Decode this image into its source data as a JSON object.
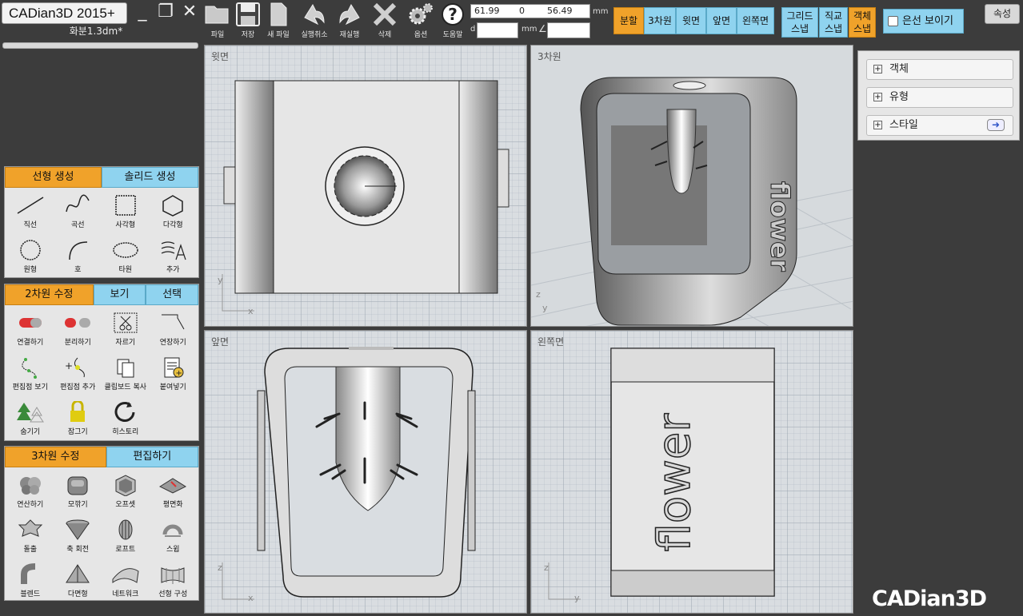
{
  "app": {
    "title": "CADian3D 2015+",
    "file_name": "화분1.3dm*",
    "brand": "CADian3D"
  },
  "window_controls": [
    "_",
    "❐",
    "✕"
  ],
  "toolbar": [
    {
      "label": "파일",
      "icon": "folder-icon"
    },
    {
      "label": "저장",
      "icon": "save-icon"
    },
    {
      "label": "새 파일",
      "icon": "new-file-icon"
    },
    {
      "label": "실행취소",
      "icon": "undo-icon"
    },
    {
      "label": "재실행",
      "icon": "redo-icon"
    },
    {
      "label": "삭제",
      "icon": "delete-icon"
    },
    {
      "label": "옵션",
      "icon": "gear-icon"
    },
    {
      "label": "도움말",
      "icon": "help-icon"
    }
  ],
  "coords": {
    "x": "61.99",
    "y": "0",
    "z": "56.49",
    "unit": "mm",
    "d_label": "d",
    "d_value": "",
    "d_unit": "mm",
    "angle_symbol": "∠",
    "angle_value": ""
  },
  "view_buttons": [
    {
      "label": "분할",
      "active": true
    },
    {
      "label": "3차원",
      "active": false
    },
    {
      "label": "윗면",
      "active": false
    },
    {
      "label": "앞면",
      "active": false
    },
    {
      "label": "왼쪽면",
      "active": false
    }
  ],
  "snap_buttons": [
    {
      "line1": "그리드",
      "line2": "스냅",
      "active": false
    },
    {
      "line1": "직교",
      "line2": "스냅",
      "active": false
    },
    {
      "line1": "객체",
      "line2": "스냅",
      "active": true
    }
  ],
  "hidden_lines": {
    "label": "은선 보이기",
    "checked": false
  },
  "properties_button": "속성",
  "panels": {
    "linear": {
      "tabs": [
        {
          "label": "선형 생성",
          "active": true
        },
        {
          "label": "솔리드 생성",
          "active": false
        }
      ],
      "tools": [
        {
          "label": "직선",
          "icon": "line-icon"
        },
        {
          "label": "곡선",
          "icon": "curve-icon"
        },
        {
          "label": "사각형",
          "icon": "rectangle-icon"
        },
        {
          "label": "다각형",
          "icon": "polygon-icon"
        },
        {
          "label": "원형",
          "icon": "circle-icon"
        },
        {
          "label": "호",
          "icon": "arc-icon"
        },
        {
          "label": "타원",
          "icon": "ellipse-icon"
        },
        {
          "label": "추가",
          "icon": "add-more-icon"
        }
      ]
    },
    "edit2d": {
      "tabs": [
        {
          "label": "2차원 수정",
          "active": true
        },
        {
          "label": "보기",
          "active": false
        },
        {
          "label": "선택",
          "active": false
        }
      ],
      "tools": [
        {
          "label": "연결하기",
          "icon": "join-icon"
        },
        {
          "label": "분리하기",
          "icon": "explode-icon"
        },
        {
          "label": "자르기",
          "icon": "trim-icon"
        },
        {
          "label": "연장하기",
          "icon": "extend-icon"
        },
        {
          "label": "편집점 보기",
          "icon": "show-points-icon"
        },
        {
          "label": "편집점 추가",
          "icon": "add-point-icon"
        },
        {
          "label": "클립보드 복사",
          "icon": "clipboard-copy-icon"
        },
        {
          "label": "붙여넣기",
          "icon": "paste-icon"
        },
        {
          "label": "숨기기",
          "icon": "hide-icon"
        },
        {
          "label": "잠그기",
          "icon": "lock-icon"
        },
        {
          "label": "히스토리",
          "icon": "history-icon"
        }
      ]
    },
    "edit3d": {
      "tabs": [
        {
          "label": "3차원 수정",
          "active": true
        },
        {
          "label": "편집하기",
          "active": false
        }
      ],
      "tools": [
        {
          "label": "연산하기",
          "icon": "boolean-icon"
        },
        {
          "label": "모깎기",
          "icon": "fillet-icon"
        },
        {
          "label": "오프셋",
          "icon": "offset-icon"
        },
        {
          "label": "평면화",
          "icon": "flatten-icon"
        },
        {
          "label": "돌출",
          "icon": "extrude-icon"
        },
        {
          "label": "축 회전",
          "icon": "revolve-icon"
        },
        {
          "label": "로프트",
          "icon": "loft-icon"
        },
        {
          "label": "스윕",
          "icon": "sweep-icon"
        },
        {
          "label": "블렌드",
          "icon": "blend-icon"
        },
        {
          "label": "다면형",
          "icon": "polyhedron-icon"
        },
        {
          "label": "네트워크",
          "icon": "network-icon"
        },
        {
          "label": "선형 구성",
          "icon": "curve-construct-icon"
        }
      ]
    }
  },
  "viewports": {
    "top": {
      "label": "윗면",
      "axis_v": "y",
      "axis_h": "x"
    },
    "persp": {
      "label": "3차원",
      "axis_v": "z",
      "axis_h": "y"
    },
    "front": {
      "label": "앞면",
      "axis_v": "z",
      "axis_h": "x"
    },
    "left": {
      "label": "왼쪽면",
      "axis_v": "z",
      "axis_h": "y",
      "model_text": "flower"
    }
  },
  "right_panel": [
    {
      "label": "객체"
    },
    {
      "label": "유형"
    },
    {
      "label": "스타일",
      "has_arrow": true
    }
  ],
  "colors": {
    "active_tab": "#f0a22a",
    "inactive_tab": "#8fd3ef",
    "background": "#3c3c3c"
  }
}
